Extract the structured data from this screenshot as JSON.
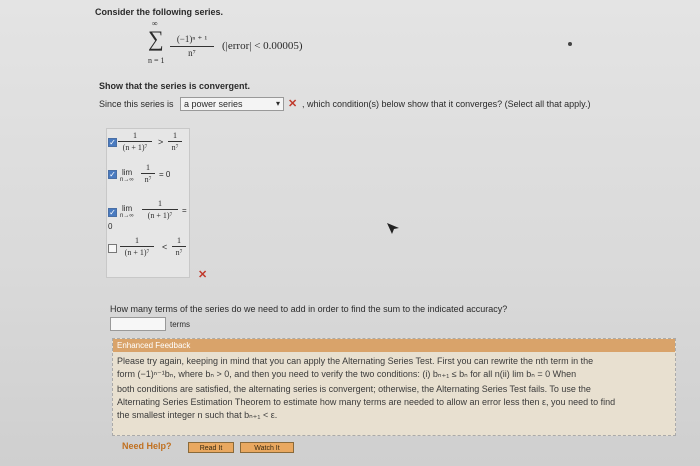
{
  "prompt": {
    "intro": "Consider the following series.",
    "series_sum_sym": "∑",
    "series_sum_top": "∞",
    "series_sum_bottom": "n = 1",
    "series_num": "(−1)ⁿ ⁺ ¹",
    "series_den": "n⁷",
    "error_text": "(|error| < 0.00005)",
    "show_text": "Show that the series is convergent.",
    "since_text": "Since this series is",
    "select_value": "a power series",
    "select_chev": "▾",
    "wrong_mark": "✕",
    "after_select": ", which condition(s) below show that it converges? (Select all that apply.)"
  },
  "options": [
    {
      "checked": true,
      "lhs_num": "1",
      "lhs_den": "(n + 1)⁷",
      "op": ">",
      "rhs_num": "1",
      "rhs_den": "n⁷"
    },
    {
      "checked": true,
      "lim": "lim",
      "lim_sub": "n→∞",
      "num": "1",
      "den": "n⁷",
      "tail": "= 0"
    },
    {
      "checked": true,
      "lim": "lim",
      "lim_sub": "n→∞",
      "num": "1",
      "den": "(n + 1)⁷",
      "tail": "=",
      "extra": "0"
    },
    {
      "checked": false,
      "lhs_num": "1",
      "lhs_den": "(n + 1)⁷",
      "op": "<",
      "rhs_num": "1",
      "rhs_den": "n⁷"
    }
  ],
  "options_wrong_mark": "✕",
  "checkmark": "✓",
  "question2": {
    "text": "How many terms of the series do we need to add in order to find the sum to the indicated accuracy?",
    "input_value": "",
    "unit": "terms"
  },
  "feedback": {
    "header": "Enhanced Feedback",
    "lines": [
      "Please try again, keeping in mind that you can apply the Alternating Series Test. First you can rewrite the nth term in the",
      "form (−1)ⁿ⁻¹bₙ, where bₙ > 0, and then you need to verify the two conditions: (i) bₙ₊₁ ≤ bₙ for all n(ii) lim bₙ = 0 When",
      "both conditions are satisfied, the alternating series is convergent; otherwise, the Alternating Series Test fails. To use the",
      "Alternating Series Estimation Theorem to estimate how many terms are needed to allow an error less then ε, you need to find",
      "the smallest integer n such that bₙ₊₁ < ε."
    ],
    "need_help": "Need Help?",
    "read_it": "Read It",
    "watch_it": "Watch It"
  }
}
